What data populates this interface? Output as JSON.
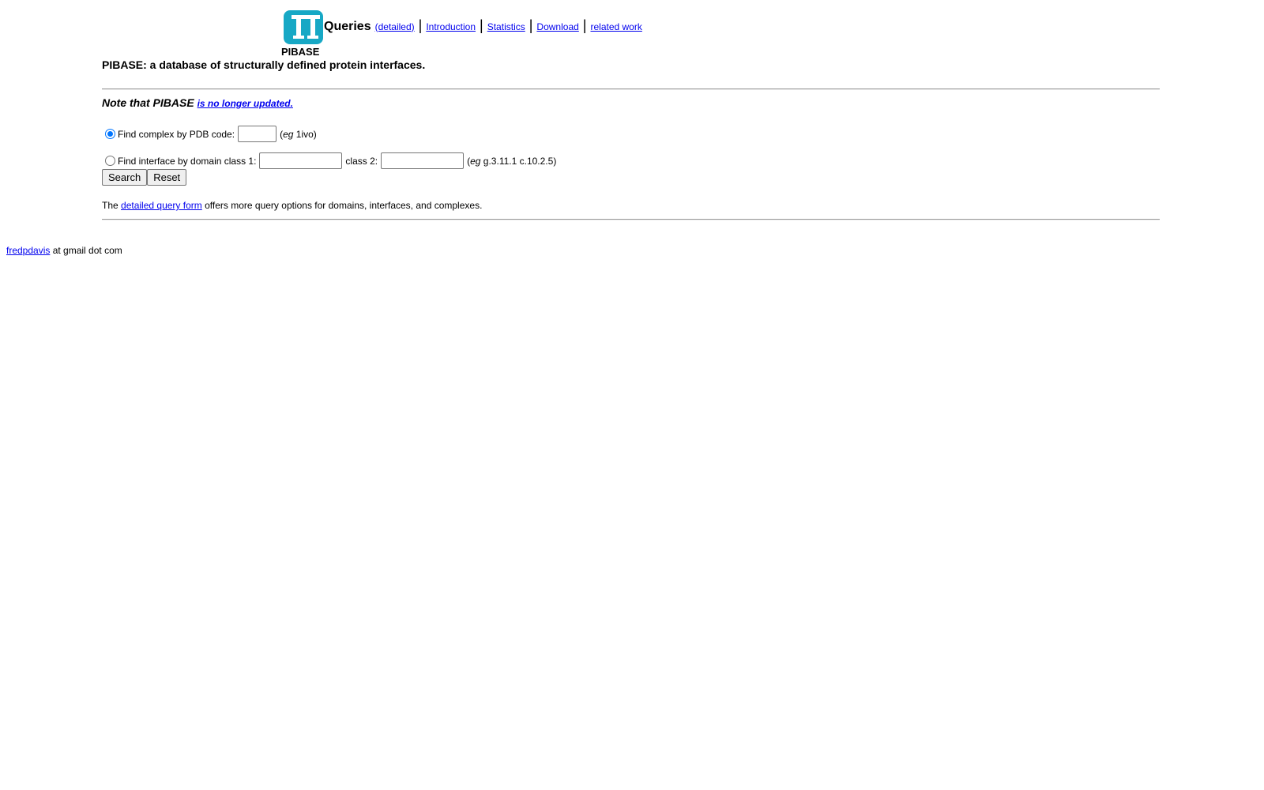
{
  "header": {
    "logo_caption": "PIBASE",
    "nav": {
      "title": "Queries",
      "detailed_link": "(detailed)",
      "separator": "|",
      "links": [
        "Introduction",
        "Statistics",
        "Download",
        "related work"
      ]
    },
    "subtitle": "PIBASE: a database of structurally defined protein interfaces.",
    "logo_color": "#17a8c5"
  },
  "note": {
    "prefix": "Note that PIBASE",
    "link": "is no longer updated."
  },
  "form": {
    "pdb_option": {
      "label": "Find complex by PDB code:",
      "value": "",
      "hint_open": "(",
      "hint_eg": "eg",
      "hint_rest": " 1ivo)",
      "checked": true
    },
    "domain_option": {
      "label": "Find interface by domain class 1:",
      "class2_label": "class 2:",
      "class1_value": "",
      "class2_value": "",
      "hint_open": "(",
      "hint_eg": "eg",
      "hint_rest": " g.3.11.1 c.10.2.5)",
      "checked": false
    },
    "search_button": "Search",
    "reset_button": "Reset"
  },
  "info": {
    "prefix": "The",
    "link": "detailed query form",
    "suffix": "offers more query options for domains, interfaces, and complexes."
  },
  "footer": {
    "link": "fredpdavis",
    "suffix": " at gmail dot com"
  }
}
